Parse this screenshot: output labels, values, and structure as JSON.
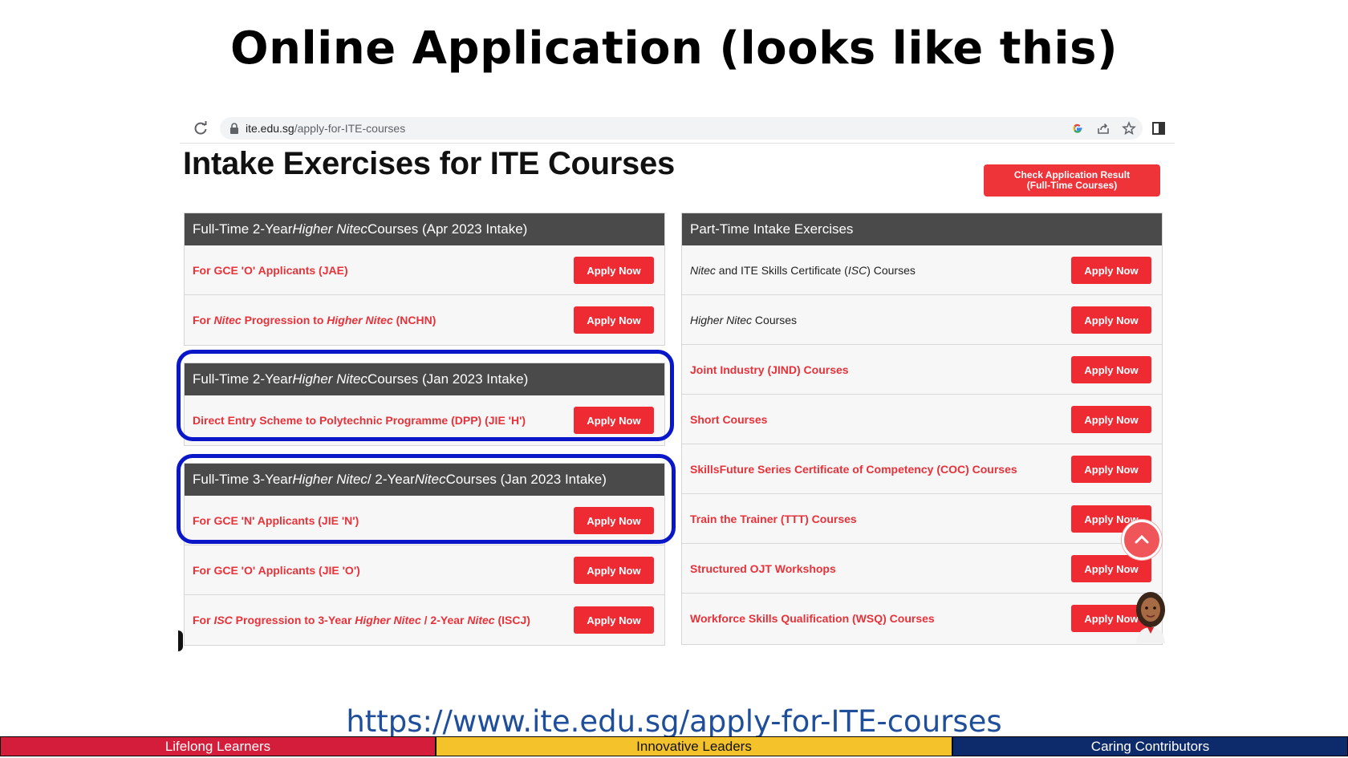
{
  "slide": {
    "title": "Online Application (looks like this)",
    "url_caption": "https://www.ite.edu.sg/apply-for-ITE-courses"
  },
  "browser": {
    "url_domain": "ite.edu.sg",
    "url_path": "/apply-for-ITE-courses"
  },
  "page": {
    "heading": "Intake Exercises for ITE Courses",
    "check_result_line1": "Check Application Result",
    "check_result_line2": "(Full-Time Courses)"
  },
  "apply_label": "Apply Now",
  "left_panels": [
    {
      "header_parts": [
        "Full-Time 2-Year ",
        "Higher Nitec",
        " Courses (Apr 2023 Intake)"
      ],
      "rows": [
        {
          "parts": [
            "For GCE 'O' Applicants (JAE)"
          ]
        },
        {
          "parts": [
            "For ",
            "Nitec",
            " Progression to ",
            "Higher Nitec",
            " (NCHN)"
          ]
        }
      ]
    },
    {
      "header_parts": [
        "Full-Time 2-Year ",
        "Higher Nitec",
        " Courses (Jan 2023 Intake)"
      ],
      "rows": [
        {
          "parts": [
            "Direct Entry Scheme to Polytechnic Programme (DPP) (JIE 'H')"
          ]
        }
      ]
    },
    {
      "header_parts": [
        "Full-Time 3-Year ",
        "Higher Nitec",
        " / 2-Year ",
        "Nitec",
        " Courses (Jan 2023 Intake)"
      ],
      "rows": [
        {
          "parts": [
            "For GCE 'N' Applicants (JIE 'N')"
          ]
        },
        {
          "parts": [
            "For GCE 'O' Applicants (JIE 'O')"
          ]
        },
        {
          "parts": [
            "For ",
            "ISC",
            " Progression to 3-Year ",
            "Higher Nitec",
            " / 2-Year ",
            "Nitec",
            " (ISCJ)"
          ]
        }
      ]
    }
  ],
  "right_panel": {
    "header": "Part-Time Intake Exercises",
    "rows": [
      {
        "parts": [
          "",
          "Nitec",
          " and ITE Skills Certificate (",
          "ISC",
          ") Courses"
        ],
        "style": "dark"
      },
      {
        "parts": [
          "",
          "Higher Nitec",
          " Courses"
        ],
        "style": "dark"
      },
      {
        "parts": [
          "Joint Industry (JIND) Courses"
        ],
        "style": "red"
      },
      {
        "parts": [
          "Short Courses"
        ],
        "style": "red"
      },
      {
        "parts": [
          "SkillsFuture Series Certificate of Competency (COC) Courses"
        ],
        "style": "red"
      },
      {
        "parts": [
          "Train the Trainer (TTT) Courses"
        ],
        "style": "red"
      },
      {
        "parts": [
          "Structured OJT Workshops"
        ],
        "style": "red"
      },
      {
        "parts": [
          "Workforce Skills Qualification (WSQ) Courses"
        ],
        "style": "red"
      }
    ]
  },
  "footer": {
    "left": "Lifelong Learners",
    "center": "Innovative Leaders",
    "right": "Caring Contributors"
  },
  "colors": {
    "accent_red": "#ee2a33",
    "header_gray": "#4a4a4a",
    "highlight_blue": "#0a17c9",
    "caption_blue": "#1f4e9a"
  }
}
